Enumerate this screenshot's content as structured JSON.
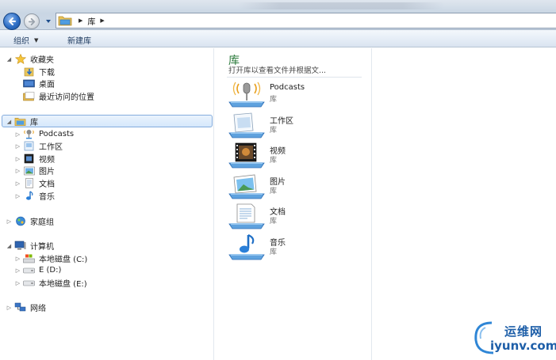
{
  "address_bar": {
    "breadcrumb": [
      "库"
    ],
    "icon": "library-folder-icon"
  },
  "command_bar": {
    "organize_label": "组织",
    "new_library_label": "新建库"
  },
  "nav": {
    "favorites": {
      "label": "收藏夹",
      "items": [
        {
          "label": "下载",
          "icon": "downloads-icon"
        },
        {
          "label": "桌面",
          "icon": "desktop-icon"
        },
        {
          "label": "最近访问的位置",
          "icon": "recent-places-icon"
        }
      ]
    },
    "libraries": {
      "label": "库",
      "selected": true,
      "items": [
        {
          "label": "Podcasts",
          "icon": "podcast-icon"
        },
        {
          "label": "工作区",
          "icon": "workspace-icon"
        },
        {
          "label": "视频",
          "icon": "video-icon"
        },
        {
          "label": "图片",
          "icon": "pictures-icon"
        },
        {
          "label": "文档",
          "icon": "documents-icon"
        },
        {
          "label": "音乐",
          "icon": "music-icon"
        }
      ]
    },
    "homegroup": {
      "label": "家庭组"
    },
    "computer": {
      "label": "计算机",
      "items": [
        {
          "label": "本地磁盘 (C:)",
          "icon": "system-drive-icon"
        },
        {
          "label": "E (D:)",
          "icon": "drive-icon"
        },
        {
          "label": "本地磁盘 (E:)",
          "icon": "drive-icon"
        }
      ]
    },
    "network": {
      "label": "网络"
    }
  },
  "content": {
    "title": "库",
    "subtitle": "打开库以查看文件并根据文...",
    "items": [
      {
        "name": "Podcasts",
        "type": "库",
        "icon": "podcast-library-icon"
      },
      {
        "name": "工作区",
        "type": "库",
        "icon": "workspace-library-icon"
      },
      {
        "name": "视频",
        "type": "库",
        "icon": "video-library-icon"
      },
      {
        "name": "图片",
        "type": "库",
        "icon": "pictures-library-icon"
      },
      {
        "name": "文档",
        "type": "库",
        "icon": "documents-library-icon"
      },
      {
        "name": "音乐",
        "type": "库",
        "icon": "music-library-icon"
      }
    ]
  },
  "watermark": {
    "brand": "运维网",
    "url": "iyunv.com"
  },
  "colors": {
    "accent": "#2b7a3b",
    "selection": "#d6e8fb",
    "selection_border": "#84acdd",
    "command_text": "#1e3a5f"
  }
}
